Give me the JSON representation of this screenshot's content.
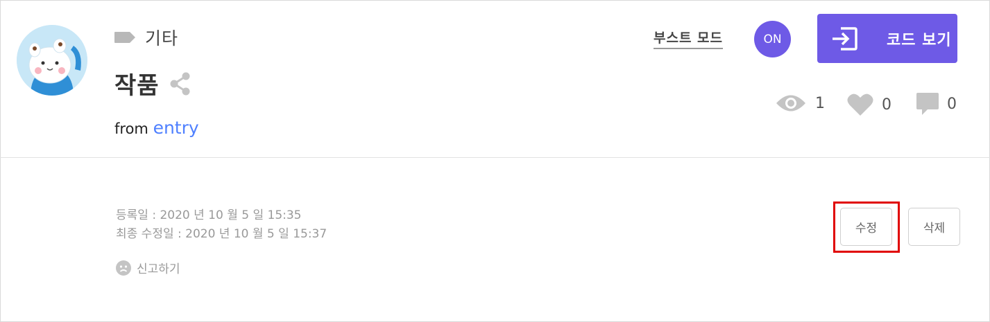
{
  "project": {
    "category": "기타",
    "title": "작품",
    "from_prefix": "from",
    "author": "entry"
  },
  "controls": {
    "boost_mode": "부스트 모드",
    "boost_state": "ON",
    "view_code": "코드 보기"
  },
  "stats": {
    "views": "1",
    "likes": "0",
    "comments": "0"
  },
  "meta": {
    "registered": "등록일 : 2020 년 10 월 5 일 15:35",
    "modified": "최종 수정일 : 2020 년 10 월 5 일 15:37",
    "report": "신고하기"
  },
  "actions": {
    "edit": "수정",
    "delete": "삭제"
  },
  "colors": {
    "accent": "#6e5ae6",
    "link": "#4f80ff",
    "highlight": "#e00000"
  }
}
